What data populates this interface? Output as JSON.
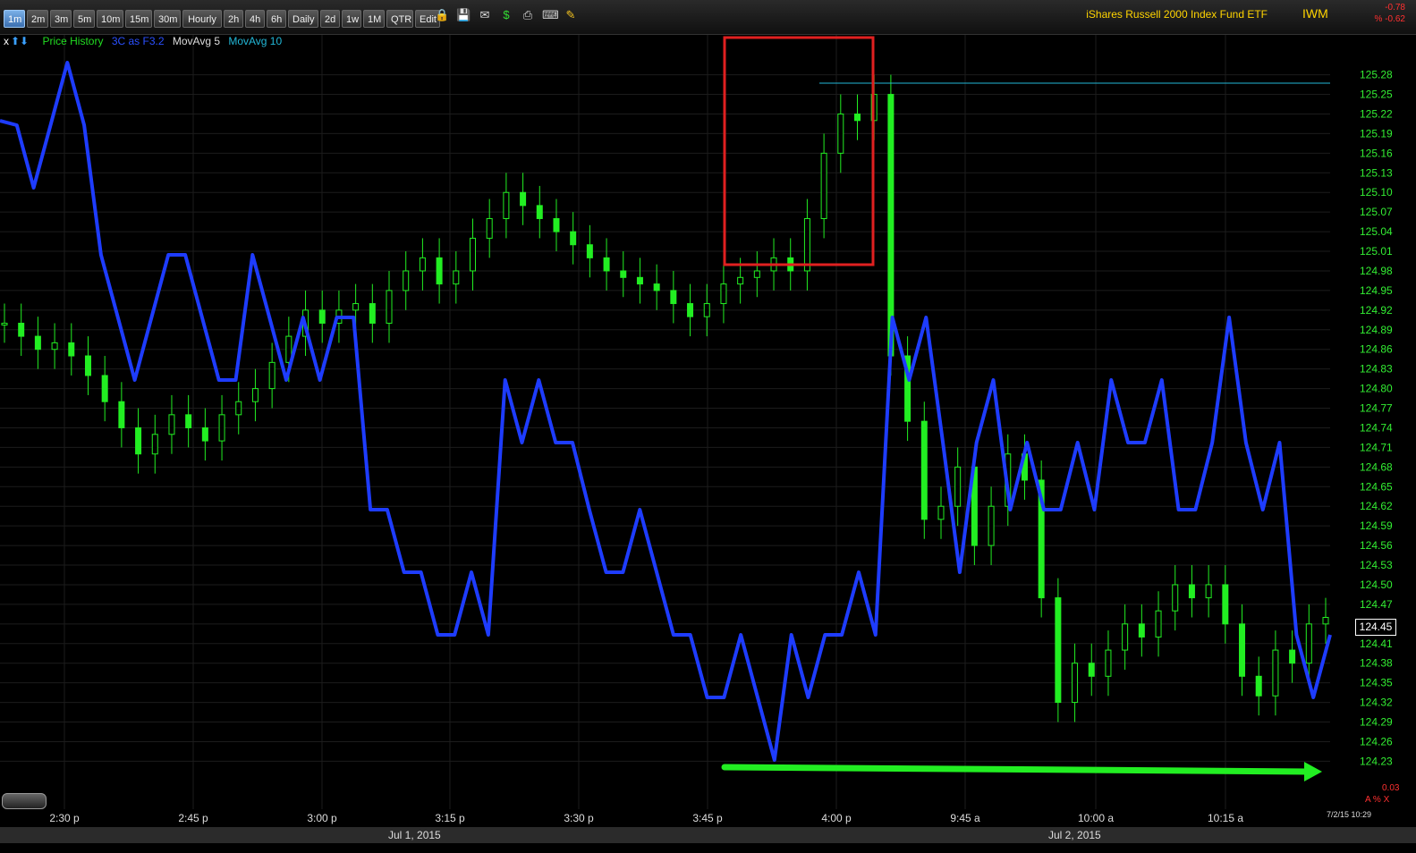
{
  "toolbar": {
    "timeframes": [
      "1m",
      "2m",
      "3m",
      "5m",
      "10m",
      "15m",
      "30m",
      "Hourly",
      "2h",
      "4h",
      "6h",
      "Daily",
      "2d",
      "1w",
      "1M",
      "QTR",
      "Edit"
    ],
    "active": "1m",
    "icons": [
      "lock-icon",
      "save-icon",
      "email-icon",
      "dollar-icon",
      "print-icon",
      "keyboard-icon",
      "pencil-icon"
    ]
  },
  "header": {
    "title": "iShares Russell 2000 Index Fund ETF",
    "symbol": "IWM",
    "change": "-0.78",
    "change_pct": "% -0.62"
  },
  "legend": {
    "controls": "x",
    "items": [
      {
        "label": "Price History",
        "color": "#22dd22"
      },
      {
        "label": "3C as F3.2",
        "color": "#2a50ff"
      },
      {
        "label": "MovAvg 5",
        "color": "#dddddd"
      },
      {
        "label": "MovAvg 10",
        "color": "#22b8d8"
      }
    ]
  },
  "colors": {
    "up": "#22ee22",
    "down": "#22ee22",
    "indicator": "#1e3cff",
    "annotation_box": "#e02020",
    "arrow": "#22ee22"
  },
  "last_price": "124.45",
  "footer": {
    "date_left": "Jul 1, 2015",
    "date_right": "Jul 2, 2015",
    "stamp": "7/2/15 10:29",
    "pct_value": "0.03",
    "pct_controls": "A % X"
  },
  "chart_data": {
    "type": "candlestick",
    "x_tick_labels": [
      "2:30 p",
      "2:45 p",
      "3:00 p",
      "3:15 p",
      "3:30 p",
      "3:45 p",
      "4:00 p",
      "9:45 a",
      "10:00 a",
      "10:15 a"
    ],
    "y_tick_labels": [
      "125.28",
      "125.25",
      "125.22",
      "125.19",
      "125.16",
      "125.13",
      "125.10",
      "125.07",
      "125.04",
      "125.01",
      "124.98",
      "124.95",
      "124.92",
      "124.89",
      "124.86",
      "124.83",
      "124.80",
      "124.77",
      "124.74",
      "124.71",
      "124.68",
      "124.65",
      "124.62",
      "124.59",
      "124.56",
      "124.53",
      "124.50",
      "124.47",
      "124.44",
      "124.41",
      "124.38",
      "124.35",
      "124.32",
      "124.29",
      "124.26",
      "124.23"
    ],
    "ylim": [
      124.21,
      125.3
    ],
    "price_close_sample": [
      124.9,
      124.88,
      124.86,
      124.87,
      124.85,
      124.82,
      124.78,
      124.74,
      124.7,
      124.73,
      124.76,
      124.74,
      124.72,
      124.76,
      124.78,
      124.8,
      124.84,
      124.88,
      124.92,
      124.9,
      124.92,
      124.93,
      124.9,
      124.95,
      124.98,
      125.0,
      124.96,
      124.98,
      125.03,
      125.06,
      125.1,
      125.08,
      125.06,
      125.04,
      125.02,
      125.0,
      124.98,
      124.97,
      124.96,
      124.95,
      124.93,
      124.91,
      124.93,
      124.96,
      124.97,
      124.98,
      125.0,
      124.98,
      125.06,
      125.16,
      125.22,
      125.21,
      125.25,
      124.85,
      124.75,
      124.6,
      124.62,
      124.68,
      124.56,
      124.62,
      124.7,
      124.66,
      124.48,
      124.32,
      124.38,
      124.36,
      124.4,
      124.44,
      124.42,
      124.46,
      124.5,
      124.48,
      124.5,
      124.44,
      124.36,
      124.33,
      124.4,
      124.38,
      124.44,
      124.45
    ],
    "indicator_line": [
      135,
      140,
      210,
      140,
      70,
      140,
      285,
      355,
      425,
      355,
      285,
      285,
      355,
      425,
      425,
      285,
      355,
      425,
      355,
      425,
      355,
      355,
      570,
      570,
      640,
      640,
      710,
      710,
      640,
      710,
      425,
      495,
      425,
      495,
      495,
      570,
      640,
      640,
      570,
      640,
      710,
      710,
      780,
      780,
      710,
      780,
      850,
      710,
      780,
      710,
      710,
      640,
      710,
      355,
      425,
      355,
      495,
      640,
      495,
      425,
      570,
      495,
      570,
      570,
      495,
      570,
      425,
      495,
      495,
      425,
      570,
      570,
      495,
      355,
      495,
      570,
      495,
      710,
      780,
      710
    ]
  },
  "annotation": {
    "type": "box",
    "note": ""
  }
}
